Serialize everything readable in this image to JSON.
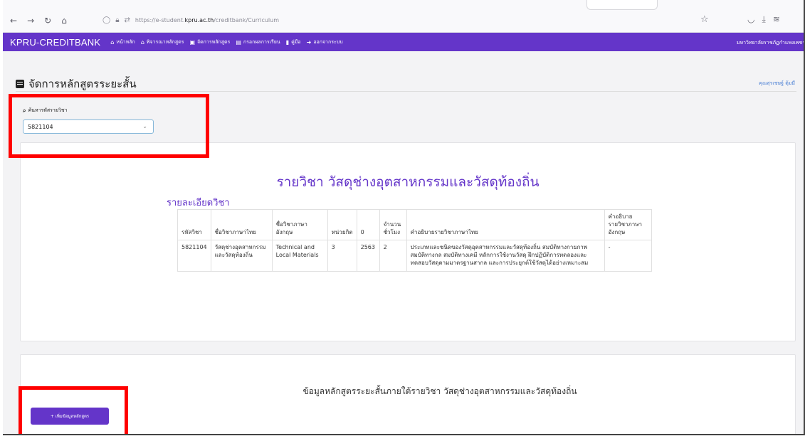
{
  "browser": {
    "url_prefix": "https://e-student.",
    "url_domain": "kpru.ac.th",
    "url_path": "/creditbank/Curriculum"
  },
  "navbar": {
    "brand": "KPRU-CREDITBANK",
    "menu": [
      {
        "label": "หน้าหลัก",
        "icon": "home-icon"
      },
      {
        "label": "พิจารณาหลักสูตร",
        "icon": "home-icon"
      },
      {
        "label": "จัดการหลักสูตร",
        "icon": "plus-square-icon"
      },
      {
        "label": "กรอกผลการเรียน",
        "icon": "calculator-icon"
      },
      {
        "label": "คู่มือ",
        "icon": "book-icon"
      },
      {
        "label": "ออกจากระบบ",
        "icon": "sign-out-icon"
      }
    ],
    "university": "มหาวิทยาลัยราชภัฏกำแพงเพชร"
  },
  "page": {
    "title": "จัดการหลักสูตรระยะสั้น",
    "user": "คุณสุรเชษฐ์ ตุ้มมี"
  },
  "search": {
    "label": "ค้นหารหัสรายวิชา",
    "value": "5821104"
  },
  "course": {
    "title": "รายวิชา วัสดุช่างอุตสาหกรรมและวัสดุท้องถิ่น",
    "detail_heading": "รายละเอียดวิชา",
    "columns": [
      "รหัสวิชา",
      "ชื่อวิชาภาษาไทย",
      "ชื่อวิชาภาษาอังกฤษ",
      "หน่วยกิต",
      "0",
      "จำนวนชั่วโมง",
      "คำอธิบายรายวิชาภาษาไทย",
      "คำอธิบายรายวิชาภาษาอังกฤษ"
    ],
    "row": [
      "5821104",
      "วัสดุช่างอุตสาหกรรมและวัสดุท้องถิ่น",
      "Technical and Local Materials",
      "3",
      "2563",
      "2",
      "ประเภทและชนิดของวัสดุอุตสาหกรรมและวัสดุท้องถิ่น สมบัติทางกายภาพ สมบัติทางกล สมบัติทางเคมี หลักการใช้งานวัสดุ ฝึกปฏิบัติการทดลองและทดสอบวัสดุตามมาตรฐานสากล และการประยุกต์ใช้วัสดุได้อย่างเหมาะสม",
      "-"
    ]
  },
  "short_course": {
    "title": "ข้อมูลหลักสูตรระยะสั้นภายใต้รายวิชา วัสดุช่างอุตสาหกรรมและวัสดุท้องถิ่น",
    "add_button": "+ เพิ่มข้อมูลหลักสูตร"
  },
  "colors": {
    "accent": "#6435c9",
    "highlight": "#ff0000"
  }
}
